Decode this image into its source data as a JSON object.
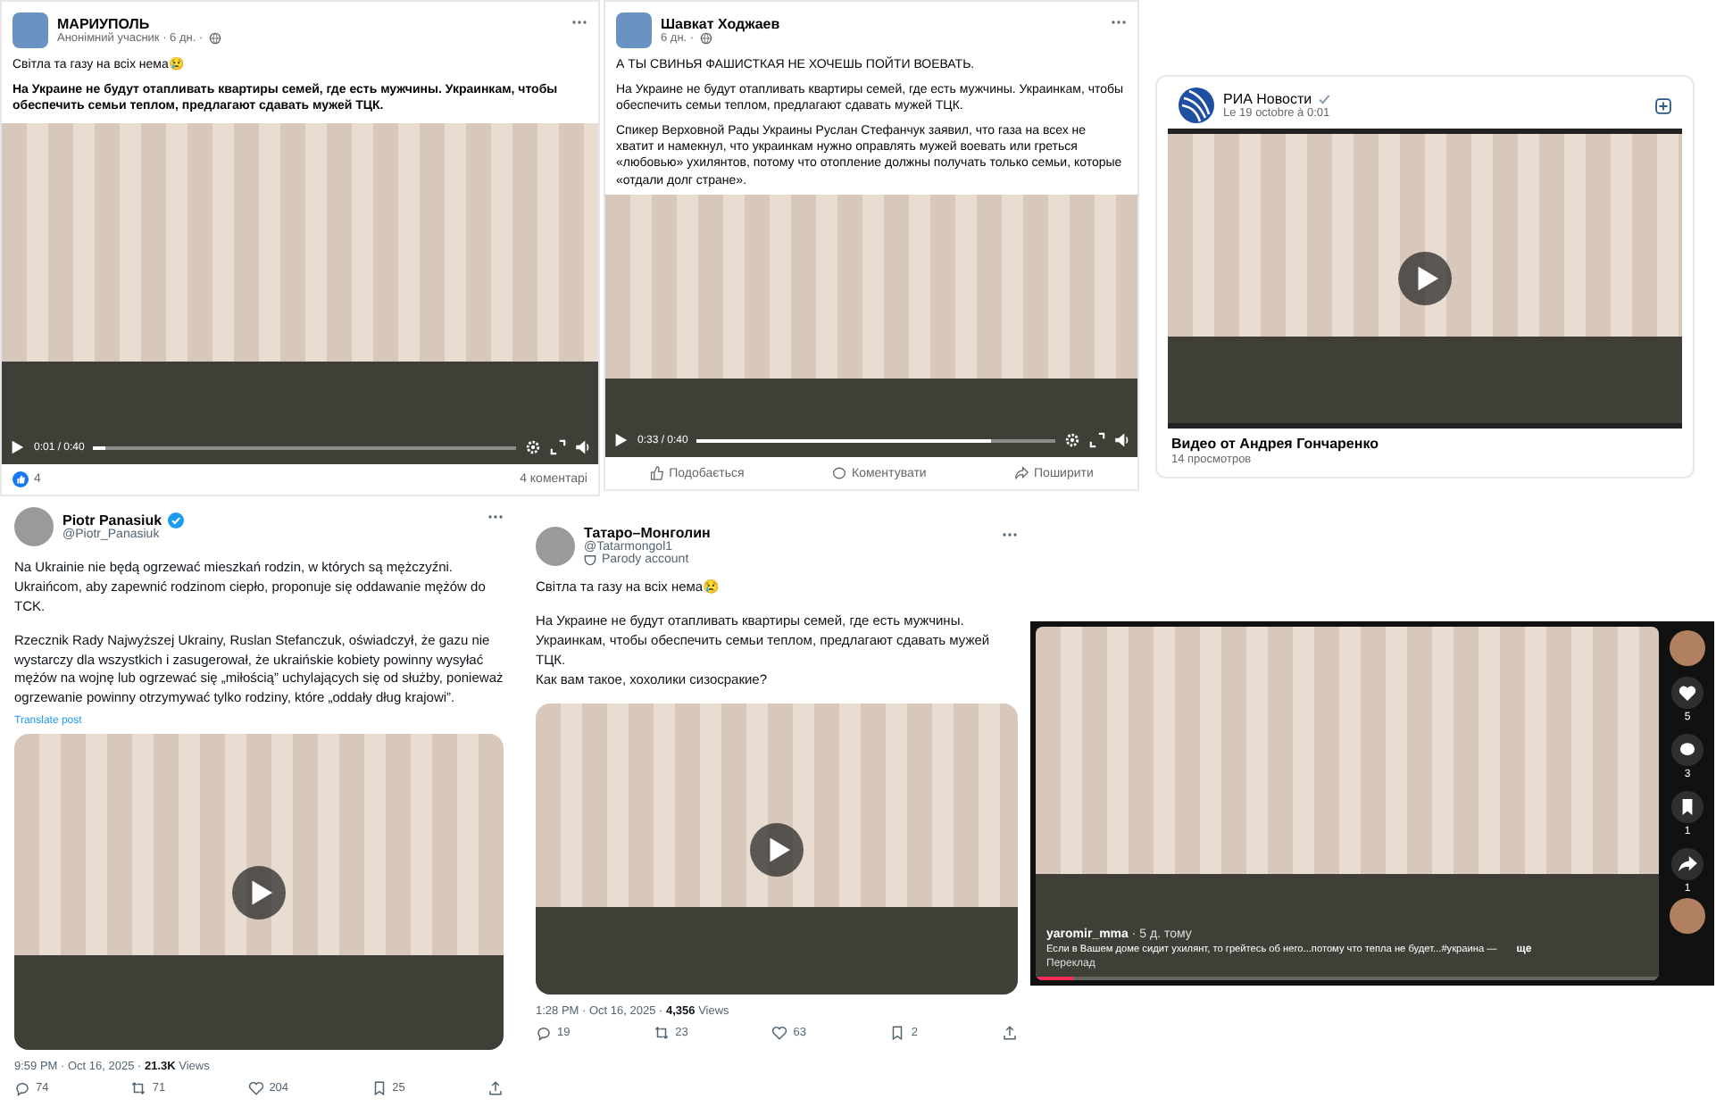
{
  "posts": [
    {
      "kind": "facebook",
      "author": "МАРИУПОЛЬ",
      "meta": "Анонімний учасник · 6 дн. ·",
      "paragraphs": [
        {
          "text": "Світла та газу на всіх нема😢",
          "bold": false
        },
        {
          "text": "На Украине не будут отапливать квартиры семей, где есть мужчины. Украинкам, чтобы обеспечить семьи теплом, предлагают сдавать мужей ТЦК.",
          "bold": true
        }
      ],
      "video": {
        "time": "0:01 / 0:40",
        "level": 0.03
      },
      "reactions": "4",
      "comments": "4 коментарі"
    },
    {
      "kind": "facebook",
      "author": "Шавкат Ходжаев",
      "meta": "6 дн. ·",
      "paragraphs": [
        {
          "text": "А ТЫ СВИНЬЯ ФАШИСТКАЯ НЕ ХОЧЕШЬ ПОЙТИ ВОЕВАТЬ.",
          "bold": false
        },
        {
          "text": "На Украине не будут отапливать квартиры семей, где есть мужчины. Украинкам, чтобы обеспечить семьи теплом, предлагают сдавать мужей ТЦК.",
          "bold": false
        },
        {
          "text": "Спикер Верховной Рады Украины Руслан Стефанчук заявил, что газа на всех не хватит и намекнул, что украинкам нужно оправлять мужей воевать или греться «любовью» ухилянтов, потому что отопление должны получать только семьи, которые «отдали долг стране».",
          "bold": false
        }
      ],
      "video": {
        "time": "0:33 / 0:40",
        "level": 0.82
      },
      "actions": [
        "Подобається",
        "Коментувати",
        "Поширити"
      ]
    },
    {
      "kind": "vk",
      "author": "РИА Новости",
      "verified": true,
      "meta": "Le 19 octobre à 0:01",
      "title": "Видео от Андрея Гончаренко",
      "views": "14 просмотров"
    },
    {
      "kind": "x",
      "author": "Piotr Panasiuk",
      "verified": true,
      "handle": "@Piotr_Panasiuk",
      "paragraphs": [
        [
          "Na Ukrainie nie będą ogrzewać mieszkań rodzin, w których są mężczyźni. Ukraińcom, aby zapewnić rodzinom ciepło, proponuje się oddawanie mężów do TCK."
        ],
        [
          "Rzecznik Rady Najwyższej Ukrainy, Ruslan Stefanczuk, oświadczył, że gazu nie wystarczy dla wszystkich i zasugerował, że ukraińskie kobiety powinny wysyłać mężów na wojnę lub ogrzewać się „miłością” uchylających się od służby, ponieważ ogrzewanie powinny otrzymywać tylko rodziny, które „oddały dług krajowi”."
        ]
      ],
      "translate": "Translate post",
      "time": "9:59 PM · Oct 16, 2025 · ",
      "views": "21.3K",
      "views_label": "Views",
      "stats": [
        "74",
        "71",
        "204",
        "25"
      ]
    },
    {
      "kind": "x",
      "author": "Татаро–Монголин",
      "handle": "@Tatarmongol1",
      "badge": "Parody account",
      "paragraphs": [
        [
          "Світла та газу на всіх нема😢"
        ],
        [
          "На Украине не будут отапливать квартиры семей, где есть мужчины. Украинкам, чтобы обеспечить семьи теплом, предлагают сдавать мужей ТЦК.",
          "Как вам такое, хохолики сизосракие?"
        ]
      ],
      "time": "1:28 PM · Oct 16, 2025 · ",
      "views": "4,356",
      "views_label": "Views",
      "stats": [
        "19",
        "23",
        "63",
        "2"
      ]
    },
    {
      "kind": "tiktok",
      "author": "yaromir_mma",
      "meta": "· 5 д. тому",
      "description": "Если в Вашем доме сидит ухилянт, то грейтесь об него...потому что тепла не будет...#украина —",
      "more": "ще",
      "translate": "Переклад",
      "video": {
        "level": 0.06
      },
      "counts": [
        "5",
        "3",
        "1",
        "1"
      ]
    }
  ]
}
